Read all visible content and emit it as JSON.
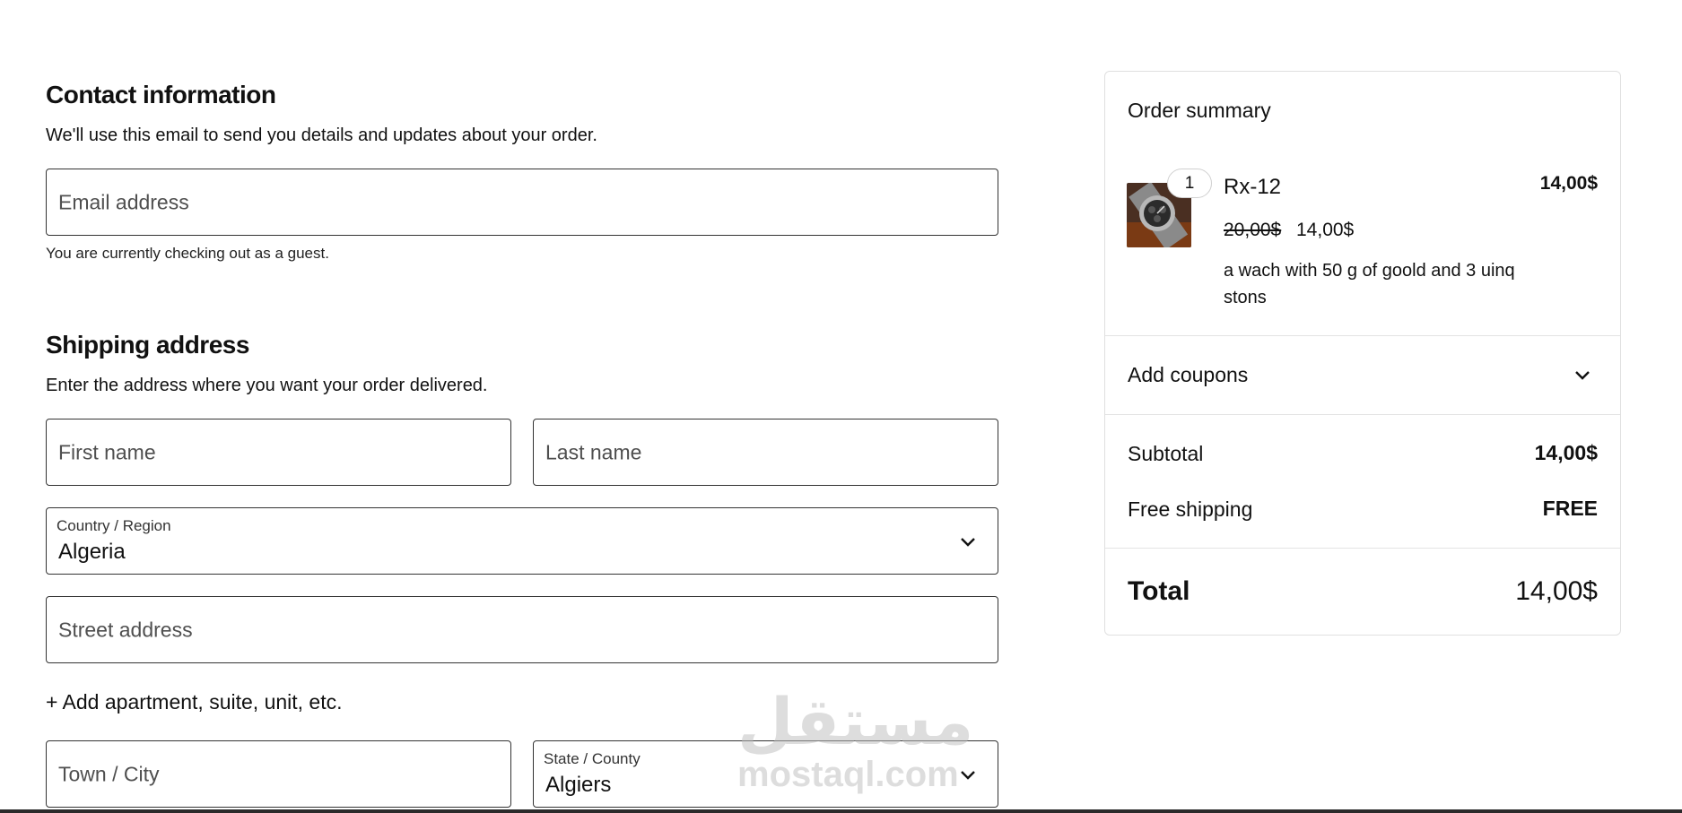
{
  "contact": {
    "title": "Contact information",
    "subtitle": "We'll use this email to send you details and updates about your order.",
    "email_placeholder": "Email address",
    "guest_note": "You are currently checking out as a guest."
  },
  "shipping": {
    "title": "Shipping address",
    "subtitle": "Enter the address where you want your order delivered.",
    "first_name_placeholder": "First name",
    "last_name_placeholder": "Last name",
    "country_label": "Country / Region",
    "country_value": "Algeria",
    "street_placeholder": "Street address",
    "add_apartment": "+ Add apartment, suite, unit, etc.",
    "city_placeholder": "Town / City",
    "state_label": "State / County",
    "state_value": "Algiers"
  },
  "summary": {
    "title": "Order summary",
    "item": {
      "quantity": "1",
      "name": "Rx-12",
      "line_total": "14,00$",
      "original_price": "20,00$",
      "sale_price": "14,00$",
      "description": "a wach with 50 g of goold and 3 uinq stons"
    },
    "coupons_label": "Add coupons",
    "subtotal_label": "Subtotal",
    "subtotal_value": "14,00$",
    "shipping_label": "Free shipping",
    "shipping_value": "FREE",
    "total_label": "Total",
    "total_value": "14,00$"
  },
  "watermark": {
    "arabic": "مستقل",
    "latin": "mostaql.com"
  },
  "icons": {
    "dropdown": "chevron-down-icon",
    "product": "watch-thumbnail"
  }
}
